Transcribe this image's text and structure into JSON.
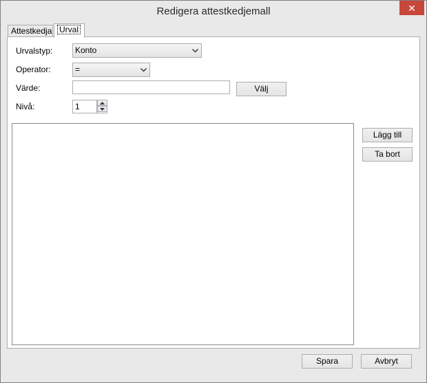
{
  "window": {
    "title": "Redigera attestkedjemall",
    "close_label": "✕"
  },
  "tabs": [
    {
      "label": "Attestkedja",
      "active": false
    },
    {
      "label": "Urval",
      "active": true
    }
  ],
  "form": {
    "urvalstyp": {
      "label": "Urvalstyp:",
      "value": "Konto"
    },
    "operator": {
      "label": "Operator:",
      "value": "="
    },
    "varde": {
      "label": "Värde:",
      "value": "",
      "button": "Välj"
    },
    "niva": {
      "label": "Nivå:",
      "value": "1"
    }
  },
  "side_buttons": {
    "add": "Lägg till",
    "remove": "Ta bort"
  },
  "footer": {
    "save": "Spara",
    "cancel": "Avbryt"
  },
  "colors": {
    "close_button": "#c7473a",
    "window_bg": "#e9e9e9"
  }
}
